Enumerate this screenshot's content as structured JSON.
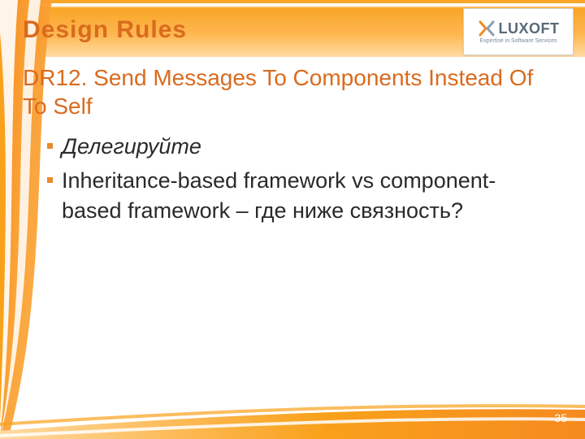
{
  "slide": {
    "title": "Design Rules",
    "subtitle": "DR12. Send Messages To Components Instead Of To Self",
    "bullets": [
      {
        "text": "Делегируйте",
        "italic": true
      },
      {
        "text": "Inheritance-based framework vs component-based framework – где ниже связность?",
        "italic": false
      }
    ],
    "page_number": "35",
    "logo": {
      "name": "LUXOFT",
      "tagline": "Expertise in Software Services"
    },
    "colors": {
      "accent_orange": "#f9a11b",
      "title_orange": "#d96b1f",
      "logo_grey": "#5a6a7a"
    }
  }
}
